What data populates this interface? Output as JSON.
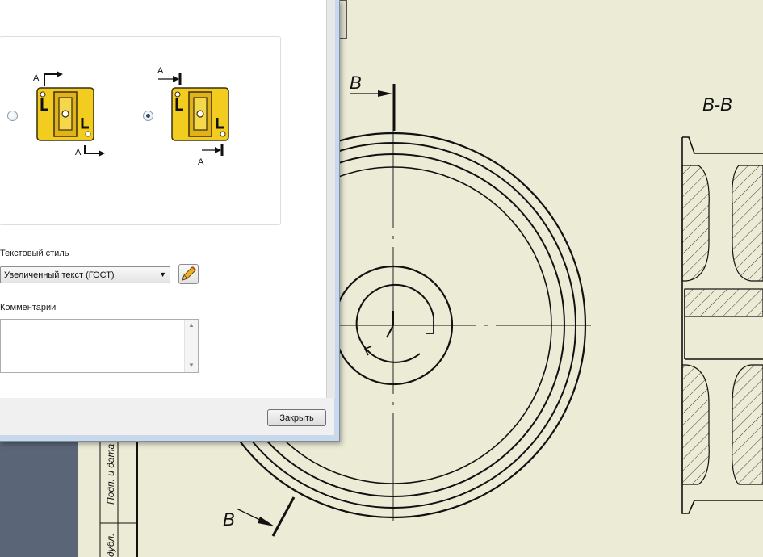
{
  "drawing": {
    "section_letter_top": "B",
    "section_letter_bottom": "B",
    "section_view_title": "B-B",
    "title_block_sign_date": "Подп. и дата",
    "title_block_dup": "дубл."
  },
  "dialog": {
    "option_left": {
      "arrow_label_top": "A",
      "arrow_label_bottom": "A",
      "selected": false
    },
    "option_right": {
      "arrow_label_top": "A",
      "arrow_label_bottom": "A",
      "selected": true
    },
    "text_style_label": "Текстовый стиль",
    "text_style_value": "Увеличенный текст (ГОСТ)",
    "comments_label": "Комментарии",
    "comments_value": "",
    "close_button": "Закрыть",
    "icon_accent": "#f2cc1f",
    "icon_outline": "#3a2f10"
  }
}
